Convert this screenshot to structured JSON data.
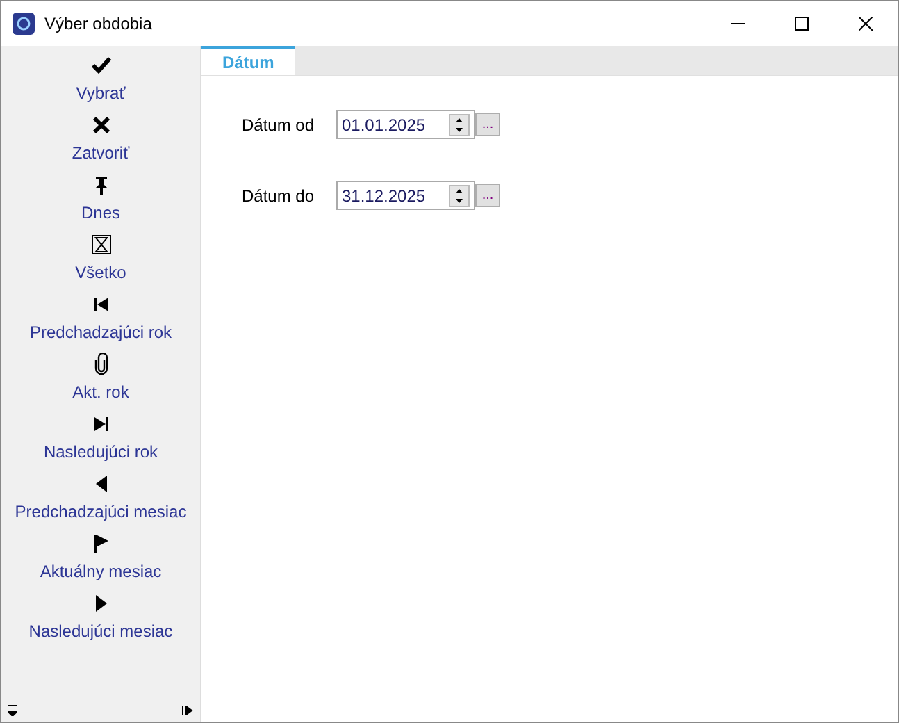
{
  "window": {
    "title": "Výber obdobia"
  },
  "sidebar": {
    "items": [
      {
        "kind": "check",
        "label": "Vybrať"
      },
      {
        "kind": "close",
        "label": "Zatvoriť"
      },
      {
        "kind": "pin",
        "label": "Dnes"
      },
      {
        "kind": "hourglass",
        "label": "Všetko"
      },
      {
        "kind": "first",
        "label": "Predchadzajúci rok"
      },
      {
        "kind": "clip",
        "label": "Akt. rok"
      },
      {
        "kind": "last",
        "label": "Nasledujúci rok"
      },
      {
        "kind": "prev",
        "label": "Predchadzajúci mesiac"
      },
      {
        "kind": "flag",
        "label": "Aktuálny mesiac"
      },
      {
        "kind": "next",
        "label": "Nasledujúci mesiac"
      }
    ]
  },
  "tabs": [
    {
      "label": "Dátum",
      "selected": true
    }
  ],
  "fields": [
    {
      "label": "Dátum od",
      "value": "01.01.2025",
      "button": "..."
    },
    {
      "label": "Dátum do",
      "value": "31.12.2025",
      "button": "..."
    }
  ]
}
